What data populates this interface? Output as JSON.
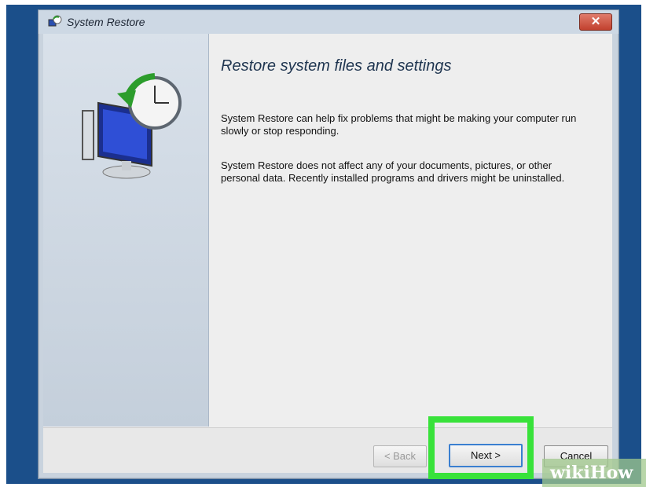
{
  "window": {
    "title": "System Restore",
    "close_label": "✕"
  },
  "content": {
    "heading": "Restore system files and settings",
    "paragraph1": "System Restore can help fix problems that might be making your computer run slowly or stop responding.",
    "paragraph2": "System Restore does not affect any of your documents, pictures, or other personal data. Recently installed programs and drivers might be uninstalled."
  },
  "buttons": {
    "back": "< Back",
    "next": "Next >",
    "cancel": "Cancel"
  },
  "watermark": "wikiHow",
  "colors": {
    "highlight": "#38e23a",
    "desktop": "#1b4f8a",
    "close": "#c2412e"
  },
  "icons": [
    "system-restore-icon",
    "close-icon",
    "restore-computer-icon"
  ]
}
